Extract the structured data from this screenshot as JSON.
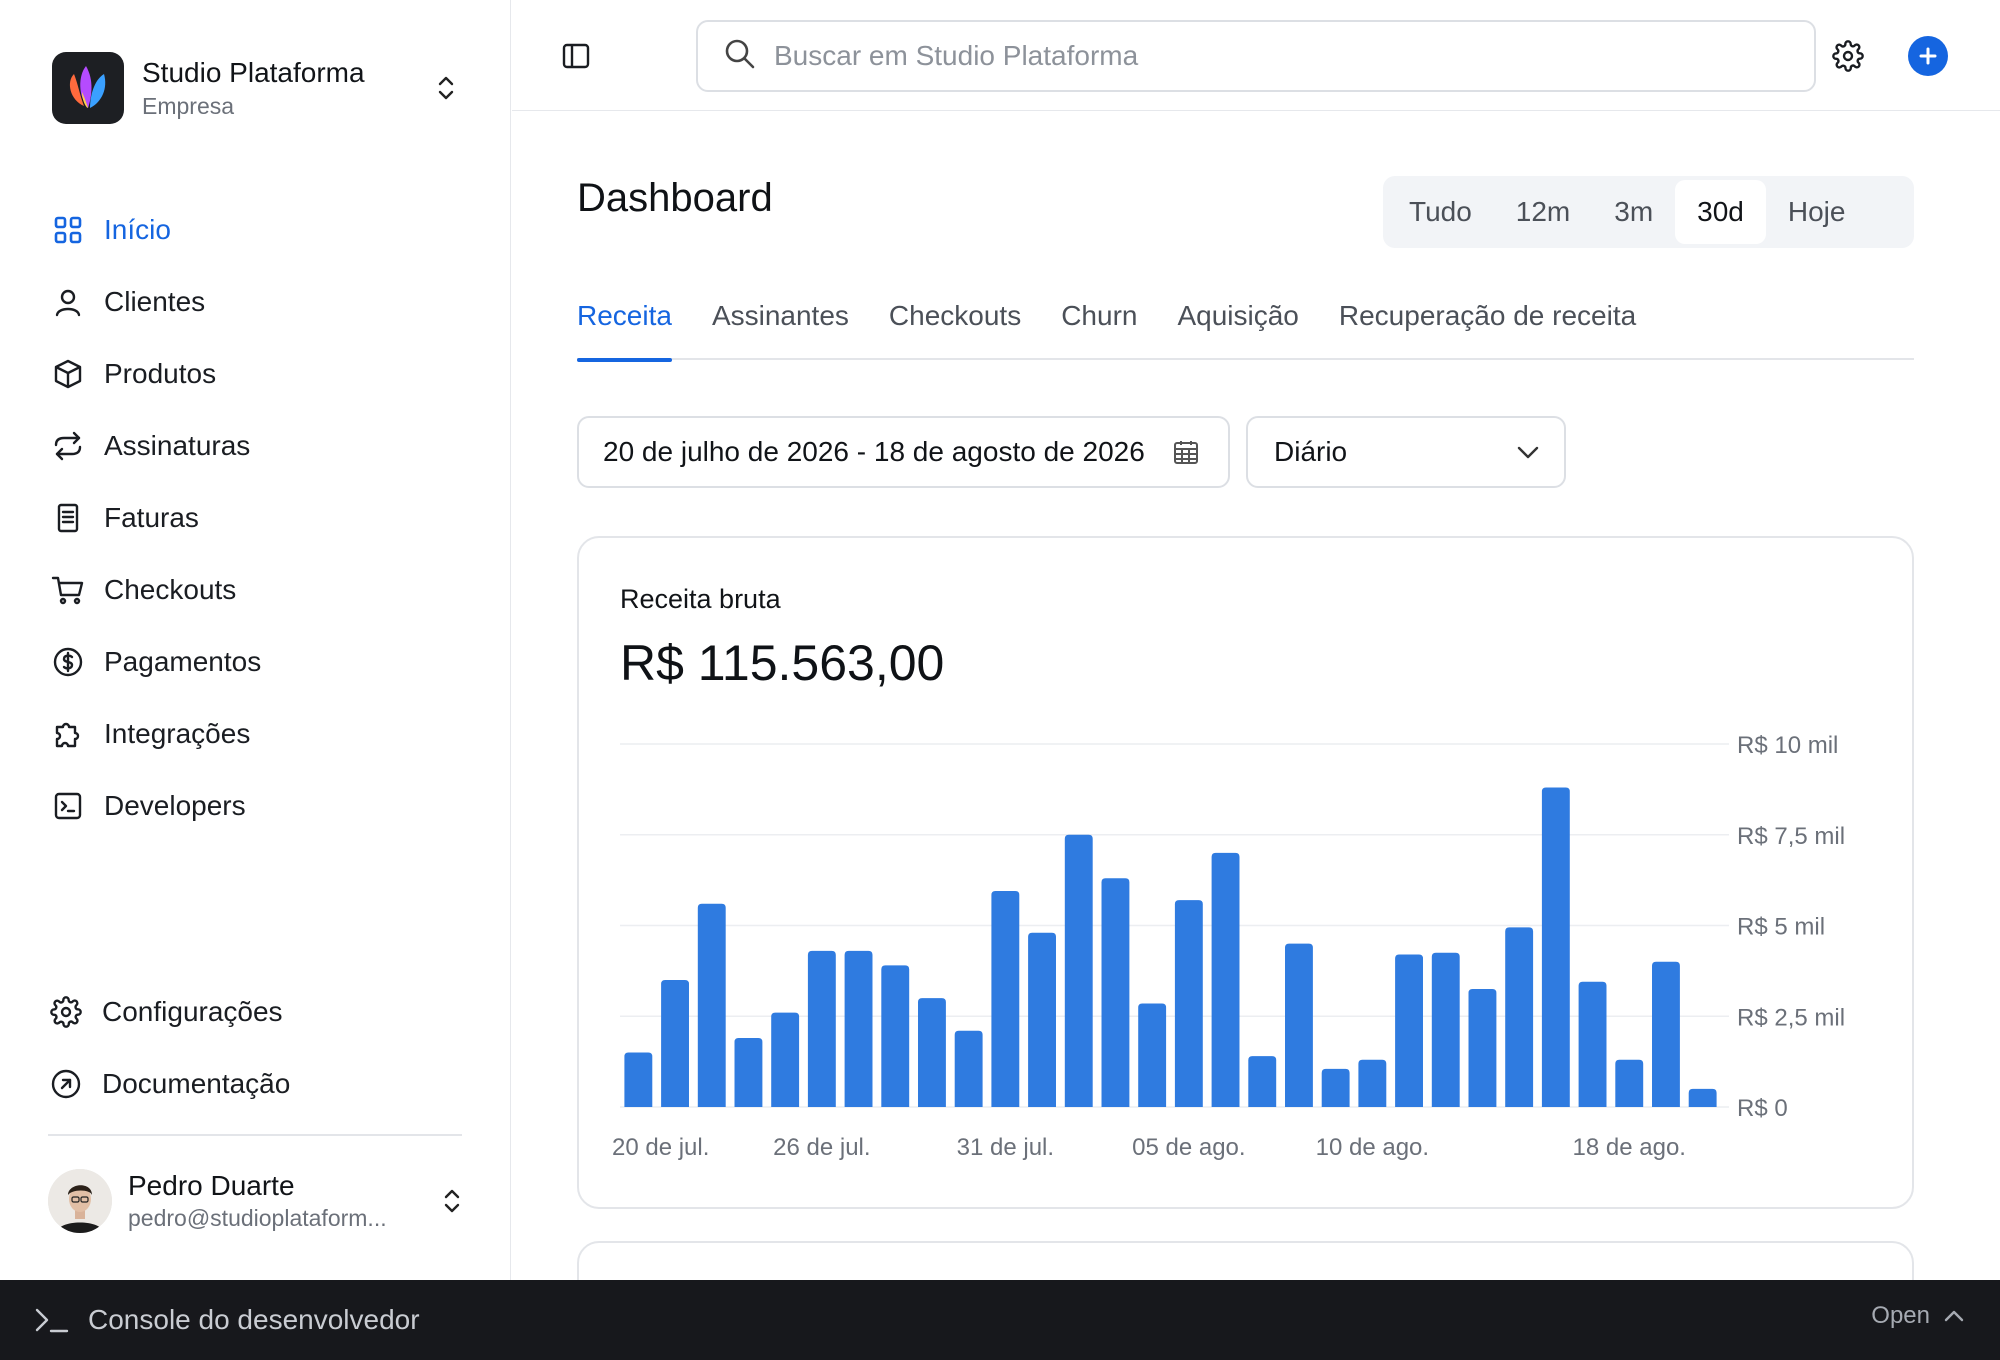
{
  "org": {
    "name": "Studio Plataforma",
    "subtitle": "Empresa"
  },
  "nav": [
    {
      "label": "Início",
      "icon": "grid-icon",
      "active": true
    },
    {
      "label": "Clientes",
      "icon": "user-icon"
    },
    {
      "label": "Produtos",
      "icon": "box-icon"
    },
    {
      "label": "Assinaturas",
      "icon": "repeat-icon"
    },
    {
      "label": "Faturas",
      "icon": "receipt-icon"
    },
    {
      "label": "Checkouts",
      "icon": "cart-icon"
    },
    {
      "label": "Pagamentos",
      "icon": "dollar-circle-icon"
    },
    {
      "label": "Integrações",
      "icon": "puzzle-icon"
    },
    {
      "label": "Developers",
      "icon": "terminal-icon"
    }
  ],
  "nav_bottom": [
    {
      "label": "Configurações",
      "icon": "gear-icon"
    },
    {
      "label": "Documentação",
      "icon": "external-circle-icon"
    }
  ],
  "user": {
    "name": "Pedro Duarte",
    "email": "pedro@studioplataform..."
  },
  "search": {
    "placeholder": "Buscar em Studio Plataforma"
  },
  "page": {
    "title": "Dashboard"
  },
  "ranges": [
    {
      "label": "Tudo"
    },
    {
      "label": "12m"
    },
    {
      "label": "3m"
    },
    {
      "label": "30d",
      "active": true
    },
    {
      "label": "Hoje"
    }
  ],
  "tabs": [
    {
      "label": "Receita",
      "active": true
    },
    {
      "label": "Assinantes"
    },
    {
      "label": "Checkouts"
    },
    {
      "label": "Churn"
    },
    {
      "label": "Aquisição"
    },
    {
      "label": "Recuperação de receita"
    }
  ],
  "filters": {
    "date_range": "20 de julho de 2026 - 18 de agosto de 2026",
    "interval": "Diário"
  },
  "card": {
    "title": "Receita bruta",
    "value": "R$ 115.563,00"
  },
  "chart_data": {
    "type": "bar",
    "title": "",
    "xlabel": "",
    "ylabel": "",
    "ylim": [
      0,
      10000
    ],
    "y_ticks": [
      {
        "value": 10000,
        "label": "R$ 10 mil"
      },
      {
        "value": 7500,
        "label": "R$ 7,5 mil"
      },
      {
        "value": 5000,
        "label": "R$ 5 mil"
      },
      {
        "value": 2500,
        "label": "R$ 2,5 mil"
      },
      {
        "value": 0,
        "label": "R$ 0"
      }
    ],
    "x_ticks": [
      {
        "index": 1,
        "label": "20 de jul."
      },
      {
        "index": 6,
        "label": "26 de jul."
      },
      {
        "index": 11,
        "label": "31 de jul."
      },
      {
        "index": 16,
        "label": "05 de ago."
      },
      {
        "index": 21,
        "label": "10 de ago."
      },
      {
        "index": 28,
        "label": "18 de ago."
      }
    ],
    "values": [
      1500,
      3500,
      5600,
      1900,
      2600,
      4300,
      4300,
      3900,
      3000,
      2100,
      5950,
      4800,
      7500,
      6300,
      2850,
      5700,
      7000,
      1400,
      4500,
      1050,
      1300,
      4200,
      4250,
      3250,
      4950,
      8800,
      3450,
      1300,
      4000,
      500
    ],
    "color": "#2f7be0",
    "grid": true,
    "y_axis_side": "right"
  },
  "console": {
    "title": "Console do desenvolvedor",
    "action": "Open"
  },
  "colors": {
    "accent": "#1565e0",
    "bar": "#2f7be0"
  }
}
